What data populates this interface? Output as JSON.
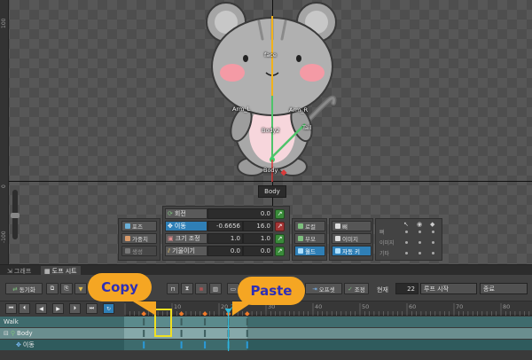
{
  "viewport": {
    "ruler_labels": [
      "100",
      "0",
      "-100"
    ],
    "bone_labels": {
      "face": "face",
      "arm_l": "Arm_L",
      "arm_r": "Arm_R",
      "tail": "Tail",
      "body2": "Body2",
      "body": "Body"
    },
    "tooltip": "Body",
    "colors": {
      "bone_yellow": "#f2b21b",
      "bone_green": "#4fc36a",
      "bone_red": "#d93b3b",
      "cheek_pink": "#f49aa5"
    }
  },
  "pose_panel": {
    "left_buttons": [
      {
        "label": "포즈",
        "icon": "pose-icon"
      },
      {
        "label": "가중치",
        "icon": "weight-icon"
      },
      {
        "label": "생성",
        "icon": "create-icon"
      }
    ],
    "properties": [
      {
        "name": "회전",
        "value2": "0.0",
        "icon": "rotate-icon"
      },
      {
        "name": "이동",
        "value1": "-0.6656",
        "value2": "16.0",
        "icon": "move-icon"
      },
      {
        "name": "크기 조정",
        "value1": "1.0",
        "value2": "1.0",
        "icon": "scale-icon"
      },
      {
        "name": "기울이기",
        "value1": "0.0",
        "value2": "0.0",
        "icon": "skew-icon"
      }
    ],
    "mode_buttons": [
      {
        "label": "로컬"
      },
      {
        "label": "부모"
      },
      {
        "label": "월드"
      }
    ],
    "view_buttons": [
      {
        "label": "뼈"
      },
      {
        "label": "이미지"
      },
      {
        "label": "자동 키"
      }
    ],
    "visibility_rows": [
      "뼈",
      "이미지",
      "기타"
    ]
  },
  "tabs": [
    {
      "label": "그래프",
      "icon": "graph-icon"
    },
    {
      "label": "도프 시트",
      "icon": "dopesheet-icon"
    }
  ],
  "toolbar": {
    "sync_label": "동기화",
    "offset_label": "오프셋",
    "adjust_label": "조정",
    "current_label": "현재",
    "current_value": "22",
    "loop_start_label": "루프 시작",
    "end_label": "종료"
  },
  "timeline": {
    "frame_numbers": [
      "10",
      "20",
      "22",
      "30",
      "40",
      "50",
      "60",
      "70",
      "80"
    ],
    "playhead_frame": 22,
    "tracks": [
      {
        "label": "Walk",
        "keys": [
          4,
          12,
          17,
          22,
          26
        ]
      },
      {
        "label": "Body",
        "keys": [
          4,
          12,
          17,
          22,
          26
        ]
      },
      {
        "label": "이동",
        "keys": [
          4,
          12,
          17,
          22,
          26
        ]
      }
    ]
  },
  "callouts": {
    "copy": "Copy",
    "paste": "Paste",
    "color": "#f5a623",
    "text_color": "#2f2fb5"
  }
}
